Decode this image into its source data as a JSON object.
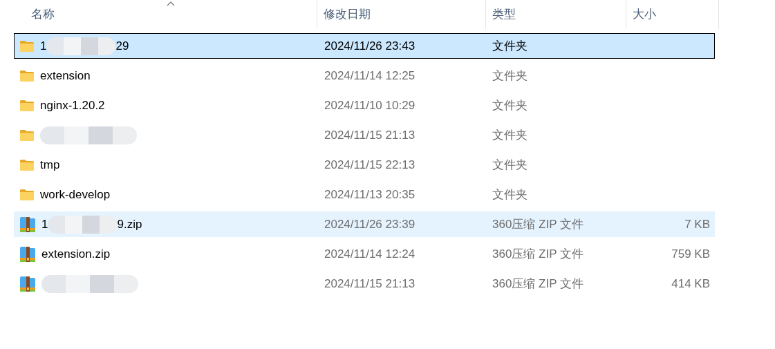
{
  "columns": [
    {
      "label": "名称",
      "sorted": true
    },
    {
      "label": "修改日期",
      "sorted": false
    },
    {
      "label": "类型",
      "sorted": false
    },
    {
      "label": "大小",
      "sorted": false
    }
  ],
  "files": [
    {
      "kind": "folder",
      "name": [
        "1",
        "29"
      ],
      "redacted": true,
      "modified": "2024/11/26 23:43",
      "type": "文件夹",
      "selected": true,
      "hovered": false
    },
    {
      "kind": "folder",
      "name": [
        "extension"
      ],
      "redacted": false,
      "modified": "2024/11/14 12:25",
      "type": "文件夹",
      "selected": false,
      "hovered": false
    },
    {
      "kind": "folder",
      "name": [
        "nginx-1.20.2"
      ],
      "redacted": false,
      "modified": "2024/11/10 10:29",
      "type": "文件夹",
      "selected": false,
      "hovered": false
    },
    {
      "kind": "folder",
      "redacted": true,
      "modified": "2024/11/15 21:13",
      "type": "文件夹",
      "selected": false,
      "hovered": false
    },
    {
      "kind": "folder",
      "name": [
        "tmp"
      ],
      "redacted": false,
      "modified": "2024/11/15 22:13",
      "type": "文件夹",
      "selected": false,
      "hovered": false
    },
    {
      "kind": "folder",
      "name": [
        "work-develop"
      ],
      "redacted": false,
      "modified": "2024/11/13 20:35",
      "type": "文件夹",
      "selected": false,
      "hovered": false
    },
    {
      "kind": "zip",
      "name": [
        "1",
        "9.zip"
      ],
      "redacted": true,
      "modified": "2024/11/26 23:39",
      "type": "360压缩 ZIP 文件",
      "size": "7 KB",
      "selected": false,
      "hovered": true
    },
    {
      "kind": "zip",
      "name": [
        "extension.zip"
      ],
      "redacted": false,
      "modified": "2024/11/14 12:24",
      "type": "360压缩 ZIP 文件",
      "size": "759 KB",
      "selected": false,
      "hovered": false
    },
    {
      "kind": "zip",
      "redacted": true,
      "modified": "2024/11/15 21:13",
      "type": "360压缩 ZIP 文件",
      "size": "414 KB",
      "selected": false,
      "hovered": false
    }
  ]
}
